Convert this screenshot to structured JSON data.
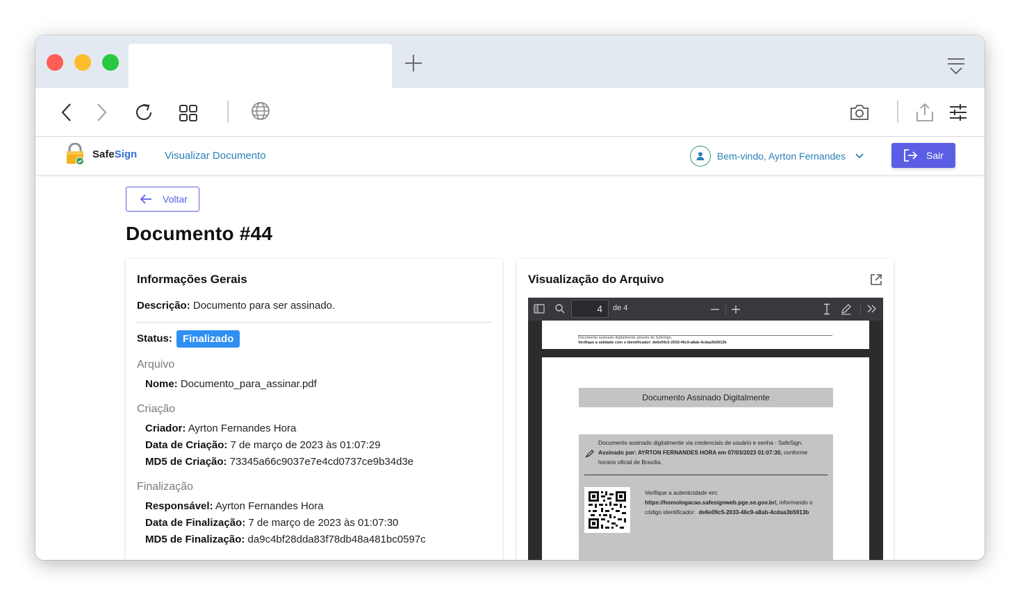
{
  "browser": {
    "tab_title": "",
    "icons": [
      "back-icon",
      "forward-icon",
      "reload-icon",
      "tabs-overview-icon",
      "globe-icon",
      "camera-icon",
      "share-icon",
      "settings-sliders-icon"
    ]
  },
  "header": {
    "logo_part1": "Safe",
    "logo_part2": "Sign",
    "nav_link": "Visualizar Documento",
    "welcome": "Bem-vindo, Ayrton Fernandes",
    "logout": "Sair",
    "colors": {
      "accent": "#5b5ee4",
      "link": "#2a7fb8",
      "badge": "#2f8ff2"
    }
  },
  "page": {
    "back": "Voltar",
    "title": "Documento #44"
  },
  "info": {
    "title": "Informações Gerais",
    "desc_label": "Descrição:",
    "desc_value": "Documento para ser assinado.",
    "status_label": "Status:",
    "status_value": "Finalizado",
    "arquivo": {
      "heading": "Arquivo",
      "name_label": "Nome:",
      "name_value": "Documento_para_assinar.pdf"
    },
    "criacao": {
      "heading": "Criação",
      "creator_label": "Criador:",
      "creator_value": "Ayrton Fernandes Hora",
      "date_label": "Data de Criação:",
      "date_value": "7 de março de 2023 às 01:07:29",
      "md5_label": "MD5 de Criação:",
      "md5_value": "73345a66c9037e7e4cd0737ce9b34d3e"
    },
    "finalizacao": {
      "heading": "Finalização",
      "resp_label": "Responsável:",
      "resp_value": "Ayrton Fernandes Hora",
      "date_label": "Data de Finalização:",
      "date_value": "7 de março de 2023 às 01:07:30",
      "md5_label": "MD5 de Finalização:",
      "md5_value": "da9c4bf28dda83f78db48a481bc0597c"
    }
  },
  "viewer": {
    "title": "Visualização do Arquivo",
    "page_number": "4",
    "page_total": "de 4",
    "footer_line1": "Documento assinado digitalmente através do SafeSign.",
    "footer_line2": "Verifique a validade com o identificador: de6e09c5-2033-46c9-a8ab-4cdaa3b5913b",
    "sig_title": "Documento Assinado Digitalmente",
    "sig_line1": "Documento assinado digitalmente via credenciais de usuário e senha - SafeSign.",
    "sig_line2_bold": "Assinado por: AYRTON FERNANDES HORA em 07/03/2023 01:07:30,",
    "sig_line2_rest": " conforme",
    "sig_line3": "horário oficial de Brasília.",
    "verify_line1": "Verifique a autenticidade em:",
    "verify_url": "https://homologacao.safesignweb.pge.se.gov.br/,",
    "verify_rest": " informando o",
    "verify_line3": "código identificador:",
    "verify_code": "de6e09c5-2033-46c9-a8ab-4cdaa3b5913b"
  }
}
